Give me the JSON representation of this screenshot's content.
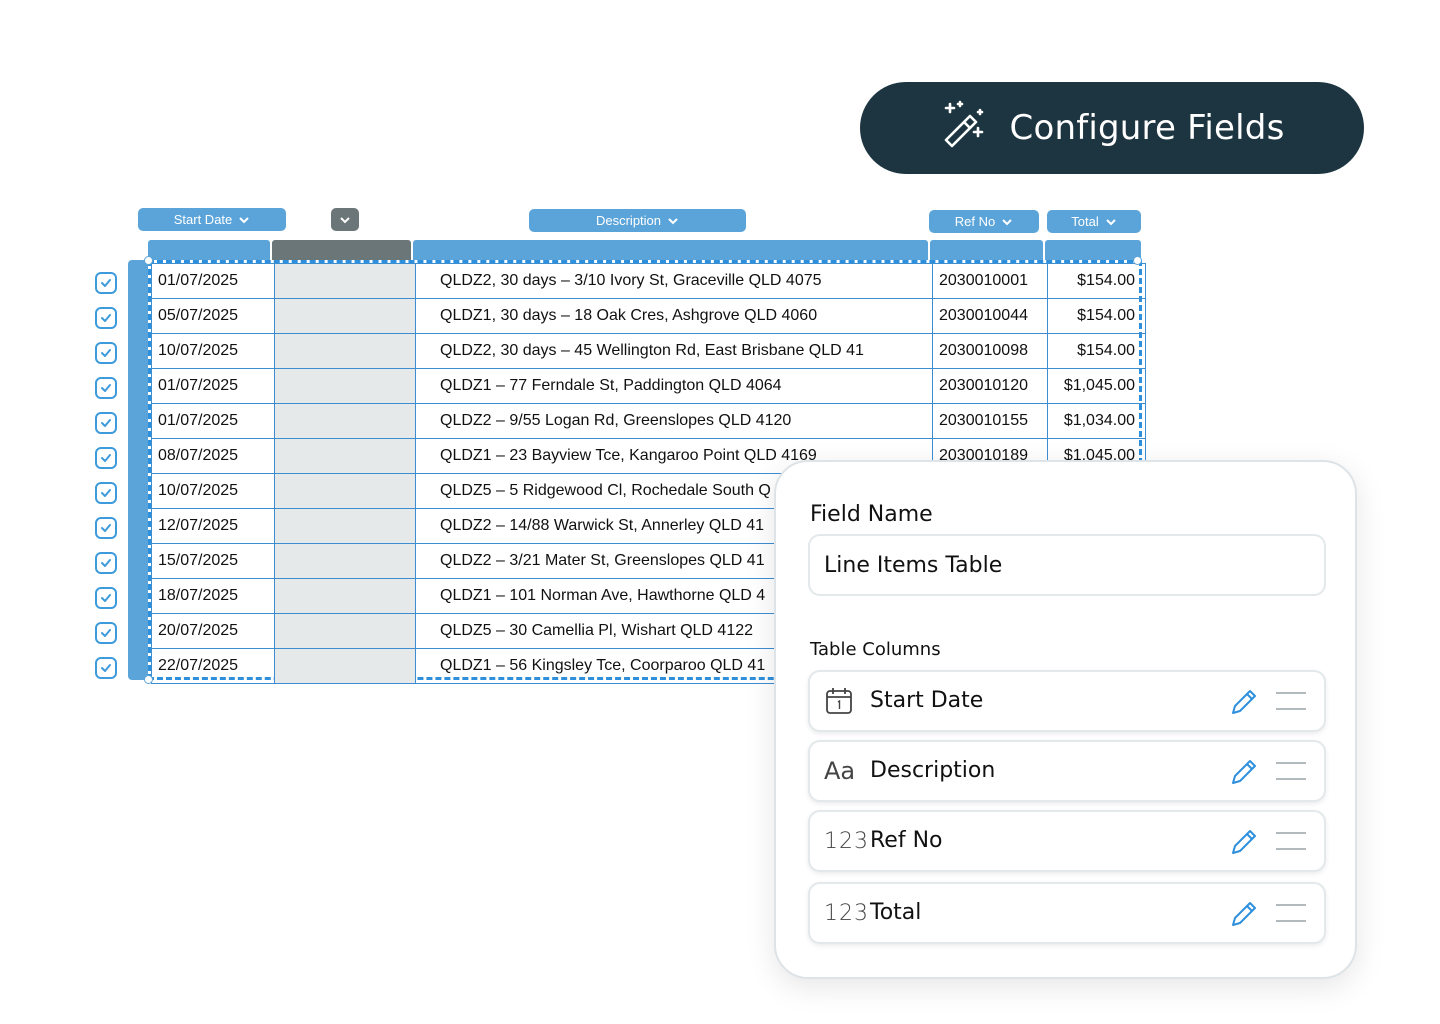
{
  "configure_button": {
    "label": "Configure Fields",
    "icon": "magic-wand-icon"
  },
  "column_chips": {
    "start_date": "Start Date",
    "description": "Description",
    "ref_no": "Ref No",
    "total": "Total"
  },
  "rows": [
    {
      "date": "01/07/2025",
      "desc": "QLDZ2, 30 days – 3/10 Ivory St, Graceville QLD 4075",
      "ref": "2030010001",
      "total": "$154.00"
    },
    {
      "date": "05/07/2025",
      "desc": "QLDZ1, 30 days – 18 Oak Cres, Ashgrove QLD 4060",
      "ref": "2030010044",
      "total": "$154.00"
    },
    {
      "date": "10/07/2025",
      "desc": "QLDZ2, 30 days – 45 Wellington Rd, East Brisbane QLD 41",
      "ref": "2030010098",
      "total": "$154.00"
    },
    {
      "date": "01/07/2025",
      "desc": "QLDZ1 – 77 Ferndale St, Paddington QLD 4064",
      "ref": "2030010120",
      "total": "$1,045.00"
    },
    {
      "date": "01/07/2025",
      "desc": "QLDZ2 – 9/55 Logan Rd, Greenslopes QLD 4120",
      "ref": "2030010155",
      "total": "$1,034.00"
    },
    {
      "date": "08/07/2025",
      "desc": "QLDZ1 – 23 Bayview Tce, Kangaroo Point QLD 4169",
      "ref": "2030010189",
      "total": "$1,045.00"
    },
    {
      "date": "10/07/2025",
      "desc": "QLDZ5 – 5 Ridgewood Cl, Rochedale South Q",
      "ref": "",
      "total": ""
    },
    {
      "date": "12/07/2025",
      "desc": "QLDZ2 – 14/88 Warwick St, Annerley QLD 41",
      "ref": "",
      "total": ""
    },
    {
      "date": "15/07/2025",
      "desc": "QLDZ2 – 3/21 Mater St, Greenslopes QLD 41",
      "ref": "",
      "total": ""
    },
    {
      "date": "18/07/2025",
      "desc": "QLDZ1 – 101 Norman Ave, Hawthorne QLD 4",
      "ref": "",
      "total": ""
    },
    {
      "date": "20/07/2025",
      "desc": "QLDZ5 – 30 Camellia Pl, Wishart QLD 4122",
      "ref": "",
      "total": ""
    },
    {
      "date": "22/07/2025",
      "desc": "QLDZ1 – 56 Kingsley Tce, Coorparoo QLD 41",
      "ref": "",
      "total": ""
    }
  ],
  "panel": {
    "field_name_label": "Field Name",
    "field_name_value": "Line Items Table",
    "table_columns_label": "Table Columns",
    "columns": [
      {
        "name": "Start Date",
        "icon": "calendar-icon",
        "icon_text": ""
      },
      {
        "name": "Description",
        "icon": "text-type-icon",
        "icon_text": "Aa"
      },
      {
        "name": "Ref No",
        "icon": "number-type-icon",
        "icon_text": "123"
      },
      {
        "name": "Total",
        "icon": "number-type-icon",
        "icon_text": "123"
      }
    ]
  },
  "colors": {
    "accent_blue": "#5ba4d9",
    "dark_teal": "#1d3540",
    "gray_column": "#6b7678"
  }
}
